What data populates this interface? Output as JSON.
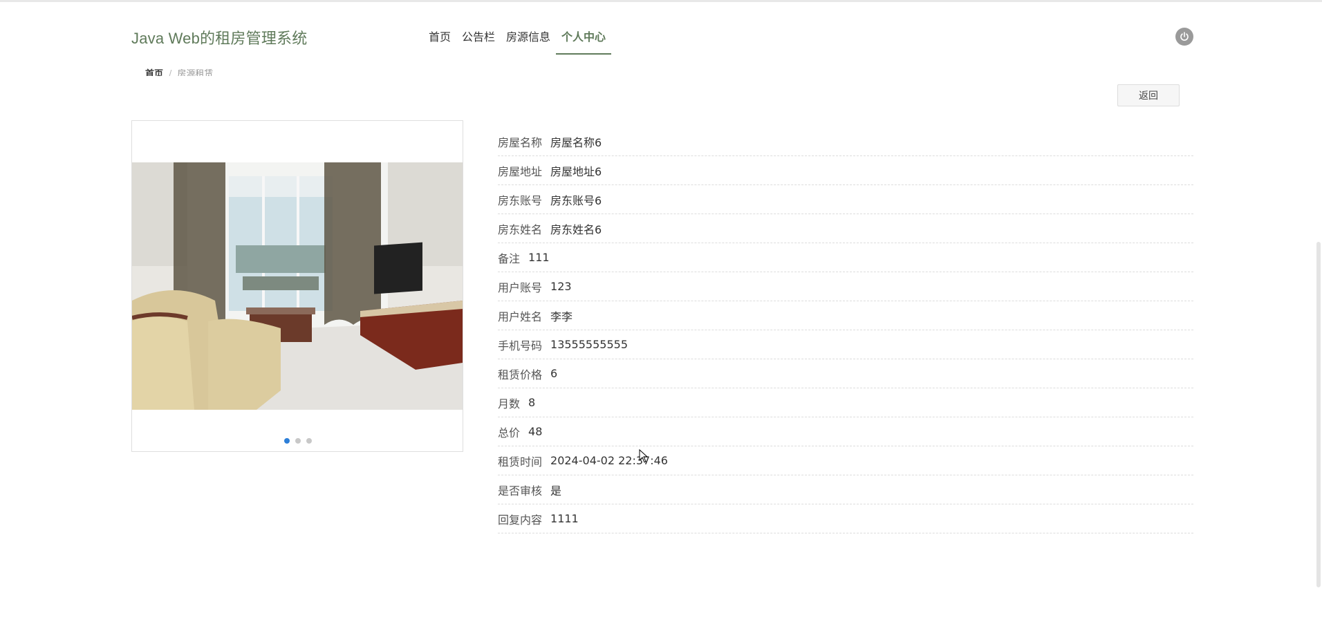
{
  "header": {
    "site_title": "Java Web的租房管理系统",
    "nav": [
      "首页",
      "公告栏",
      "房源信息",
      "个人中心"
    ],
    "active_nav": 3,
    "power_icon": "power-icon"
  },
  "breadcrumb": {
    "home": "首页",
    "separator": "/",
    "current": "房源租赁"
  },
  "back_button": "返回",
  "carousel": {
    "slide_count": 3,
    "active_index": 0
  },
  "details": [
    {
      "label": "房屋名称",
      "value": "房屋名称6"
    },
    {
      "label": "房屋地址",
      "value": "房屋地址6"
    },
    {
      "label": "房东账号",
      "value": "房东账号6"
    },
    {
      "label": "房东姓名",
      "value": "房东姓名6"
    },
    {
      "label": "备注",
      "value": "111"
    },
    {
      "label": "用户账号",
      "value": "123"
    },
    {
      "label": "用户姓名",
      "value": "李李"
    },
    {
      "label": "手机号码",
      "value": "13555555555"
    },
    {
      "label": "租赁价格",
      "value": "6"
    },
    {
      "label": "月数",
      "value": "8"
    },
    {
      "label": "总价",
      "value": "48"
    },
    {
      "label": "租赁时间",
      "value": "2024-04-02 22:37:46"
    },
    {
      "label": "是否审核",
      "value": "是"
    },
    {
      "label": "回复内容",
      "value": "1111"
    }
  ],
  "colors": {
    "accent": "#5f7a5a",
    "dot_active": "#2d7fd8"
  }
}
